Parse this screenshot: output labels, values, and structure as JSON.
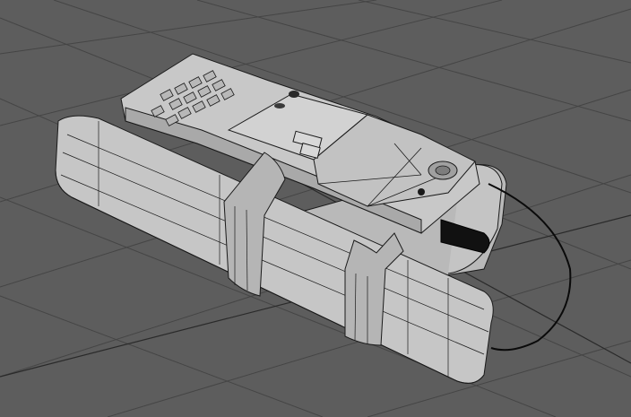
{
  "viewport": {
    "background_color": "#5d5d5d",
    "grid_color": "#454545",
    "grid_axis_color": "#2a2a2a",
    "mesh_fill_color": "#c9c9c9",
    "mesh_shade_color": "#a8a8a8",
    "wire_color": "#1a1a1a",
    "cable_color": "#0a0a0a"
  },
  "objects": [
    {
      "name": "cylinder-tube-front",
      "kind": "mesh"
    },
    {
      "name": "cylinder-tube-back",
      "kind": "mesh"
    },
    {
      "name": "mobile-phone",
      "kind": "mesh"
    },
    {
      "name": "phone-keypad",
      "kind": "mesh"
    },
    {
      "name": "strap-left",
      "kind": "mesh"
    },
    {
      "name": "strap-right",
      "kind": "mesh"
    },
    {
      "name": "antenna-connector",
      "kind": "mesh"
    },
    {
      "name": "detonator-wire",
      "kind": "spline"
    }
  ]
}
